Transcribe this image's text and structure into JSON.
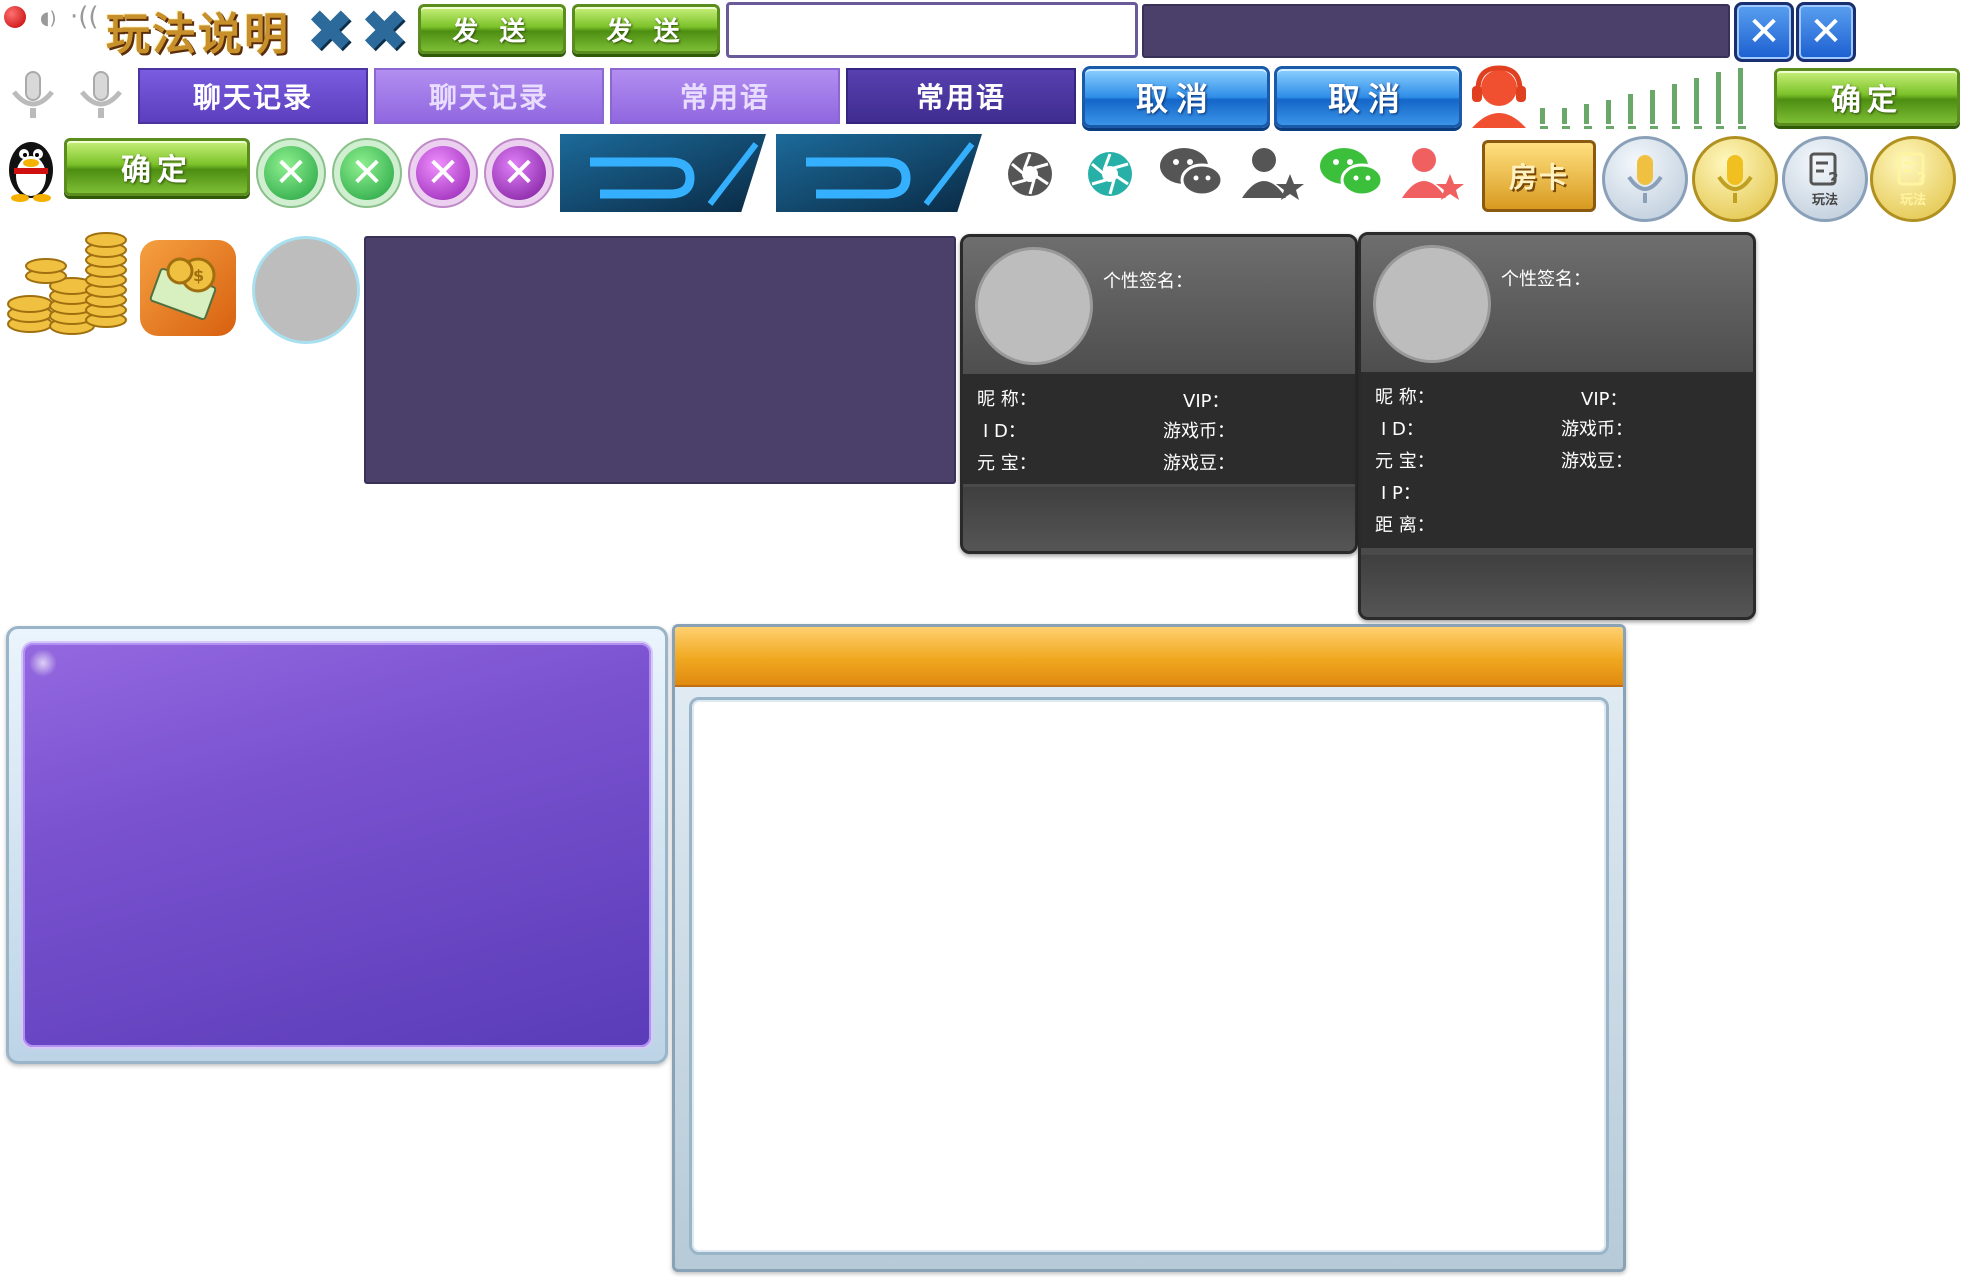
{
  "header": {
    "title": "玩法说明",
    "send_label_1": "发 送",
    "send_label_2": "发 送"
  },
  "tabs": {
    "chat_record_1": "聊天记录",
    "chat_record_2": "聊天记录",
    "phrases_1": "常用语",
    "phrases_2": "常用语"
  },
  "buttons": {
    "cancel_1": "取消",
    "cancel_2": "取消",
    "confirm_top": "确定",
    "confirm_left": "确定",
    "room_card": "房卡",
    "rules_1": "玩法",
    "rules_2": "玩法"
  },
  "card_small": {
    "signature_label": "个性签名：",
    "nickname_label": "昵  称：",
    "id_label": "I  D：",
    "yuanbao_label": "元  宝：",
    "vip_label": "VIP：",
    "coins_label": "游戏币：",
    "beans_label": "游戏豆："
  },
  "card_large": {
    "signature_label": "个性签名：",
    "nickname_label": "昵  称：",
    "id_label": "I  D：",
    "yuanbao_label": "元  宝：",
    "ip_label": "I  P：",
    "distance_label": "距  离：",
    "vip_label": "VIP：",
    "coins_label": "游戏币：",
    "beans_label": "游戏豆："
  },
  "colors": {
    "purple_panel": "#4b406a",
    "tab_purple": "#6a4fd0",
    "green_button": "#7cc22a",
    "blue_button": "#2f8ee8",
    "gold": "#f0b040"
  },
  "icons": [
    "record-dot-icon",
    "speaker-icon",
    "mic-icon",
    "qq-penguin-icon",
    "shutter-icon",
    "wechat-icon",
    "user-star-icon",
    "service-headset-icon",
    "signal-bars-icon",
    "coins-icon",
    "money-icon"
  ]
}
